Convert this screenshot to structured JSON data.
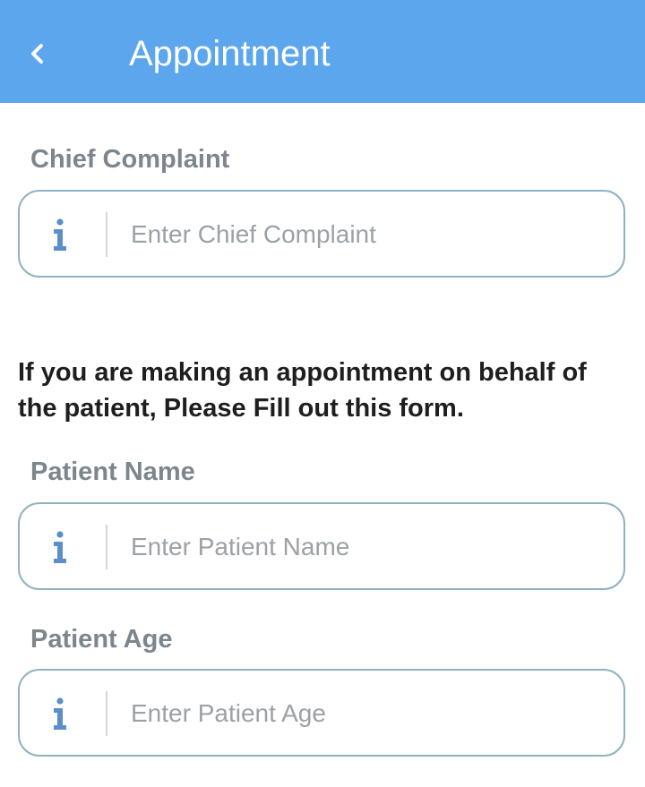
{
  "header": {
    "title": "Appointment",
    "back_icon": "chevron-left-icon",
    "background_color": "#5ba6ec"
  },
  "form": {
    "chief_complaint": {
      "label": "Chief Complaint",
      "placeholder": "Enter Chief Complaint",
      "value": "",
      "icon": "info-icon"
    },
    "notice": "If you are making an appointment on behalf of the patient, Please Fill out this form.",
    "patient_name": {
      "label": "Patient Name",
      "placeholder": "Enter Patient Name",
      "value": "",
      "icon": "info-icon"
    },
    "patient_age": {
      "label": "Patient Age",
      "placeholder": "Enter Patient Age",
      "value": "",
      "icon": "info-icon"
    }
  },
  "colors": {
    "label": "#7d858d",
    "field_border": "#8fb2c2",
    "icon": "#5b8fcb"
  }
}
